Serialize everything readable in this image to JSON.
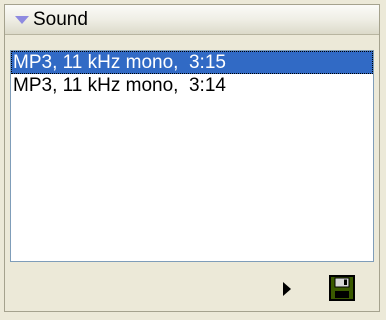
{
  "panel": {
    "title": "Sound"
  },
  "list": {
    "items": [
      {
        "label": "MP3, 11 kHz mono,  3:15",
        "selected": true
      },
      {
        "label": "MP3, 11 kHz mono,  3:14",
        "selected": false
      }
    ]
  },
  "footer": {
    "play_icon": "play-icon",
    "save_icon": "floppy-disk-icon"
  },
  "colors": {
    "selection": "#316ac5",
    "panel_bg": "#ece9d8",
    "accent_triangle": "#8e8ae0",
    "save_icon": "#3a5a00"
  }
}
